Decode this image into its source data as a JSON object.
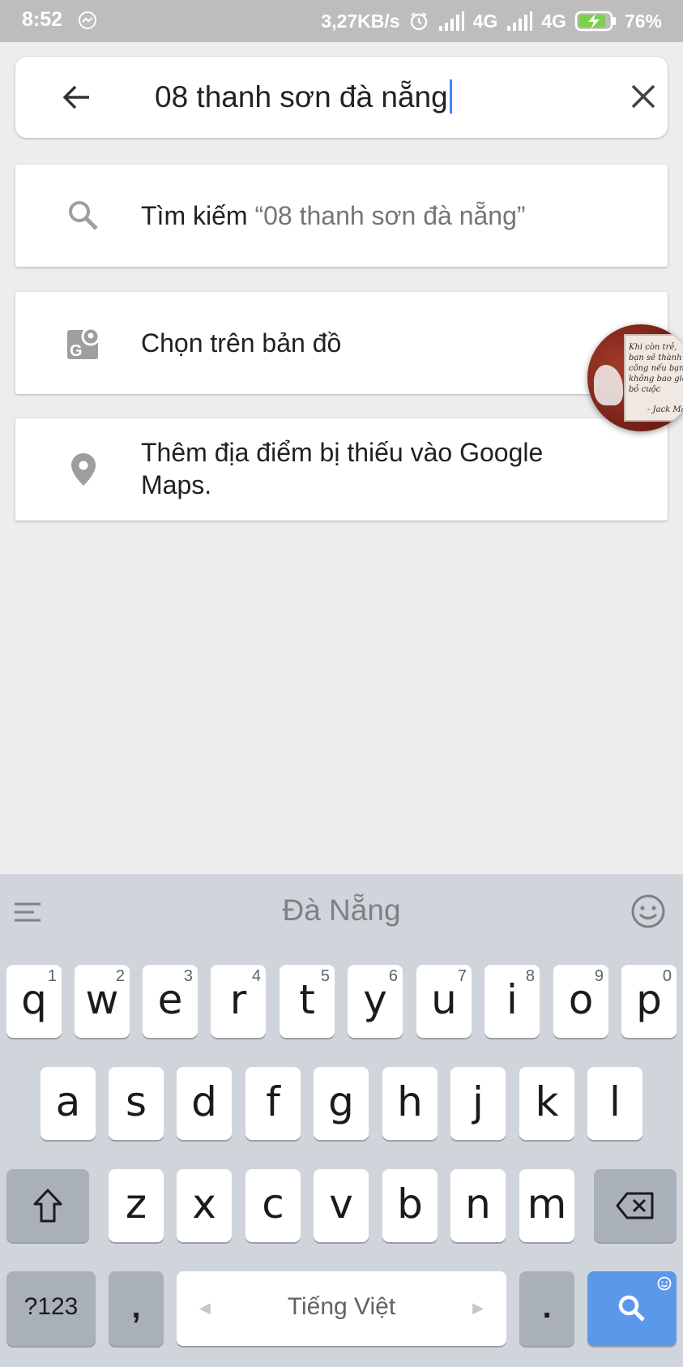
{
  "status_bar": {
    "time": "8:52",
    "speed": "3,27KB/s",
    "net1": "4G",
    "net2": "4G",
    "battery": "76%"
  },
  "search": {
    "query": "08 thanh sơn đà nẵng",
    "back_icon": "arrow-left-icon",
    "clear_icon": "close-icon"
  },
  "results": [
    {
      "icon": "search-icon",
      "prefix": "Tìm kiếm",
      "quoted": "“08 thanh sơn đà nẵng”"
    },
    {
      "icon": "map-pick-icon",
      "label": "Chọn trên bản đồ"
    },
    {
      "icon": "place-pin-icon",
      "line1": "Thêm địa điểm bị thiếu vào Google",
      "line2": "Maps."
    }
  ],
  "bubble": {
    "quote": "Khi còn trẻ, bạn sẽ thành công nếu bạn không bao giờ bỏ cuộc",
    "author": "- Jack Ma-"
  },
  "keyboard": {
    "suggestion": "Đà Nẵng",
    "row1": [
      {
        "ch": "q",
        "num": "1"
      },
      {
        "ch": "w",
        "num": "2"
      },
      {
        "ch": "e",
        "num": "3"
      },
      {
        "ch": "r",
        "num": "4"
      },
      {
        "ch": "t",
        "num": "5"
      },
      {
        "ch": "y",
        "num": "6"
      },
      {
        "ch": "u",
        "num": "7"
      },
      {
        "ch": "i",
        "num": "8"
      },
      {
        "ch": "o",
        "num": "9"
      },
      {
        "ch": "p",
        "num": "0"
      }
    ],
    "row2": [
      "a",
      "s",
      "d",
      "f",
      "g",
      "h",
      "j",
      "k",
      "l"
    ],
    "row3": [
      "z",
      "x",
      "c",
      "v",
      "b",
      "n",
      "m"
    ],
    "sym_label": "?123",
    "comma": ",",
    "space_label": "Tiếng Việt",
    "period": "."
  },
  "colors": {
    "accent": "#4285f4",
    "search_key": "#5c98ea",
    "keyboard_bg": "#d0d5dc"
  }
}
